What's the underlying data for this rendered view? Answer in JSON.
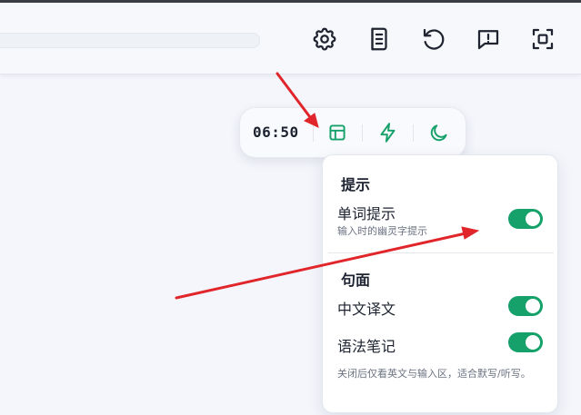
{
  "header": {
    "icons": [
      "gear-icon",
      "book-icon",
      "refresh-icon",
      "feedback-icon",
      "fullscreen-icon"
    ]
  },
  "toolbar": {
    "timer": "06:50",
    "buttons": [
      "layout-icon",
      "lightning-icon",
      "moon-icon"
    ],
    "accent": "#16a06a"
  },
  "panel": {
    "hints": {
      "title": "提示",
      "word_hint": {
        "label": "单词提示",
        "desc": "输入时的幽灵字提示",
        "on": true
      }
    },
    "sentence": {
      "title": "句面",
      "translation": {
        "label": "中文译文",
        "on": true
      },
      "grammar": {
        "label": "语法笔记",
        "on": true
      }
    },
    "footnote": "关闭后仅看英文与输入区，适合默写/听写。"
  },
  "annotation_color": "#e0262a"
}
